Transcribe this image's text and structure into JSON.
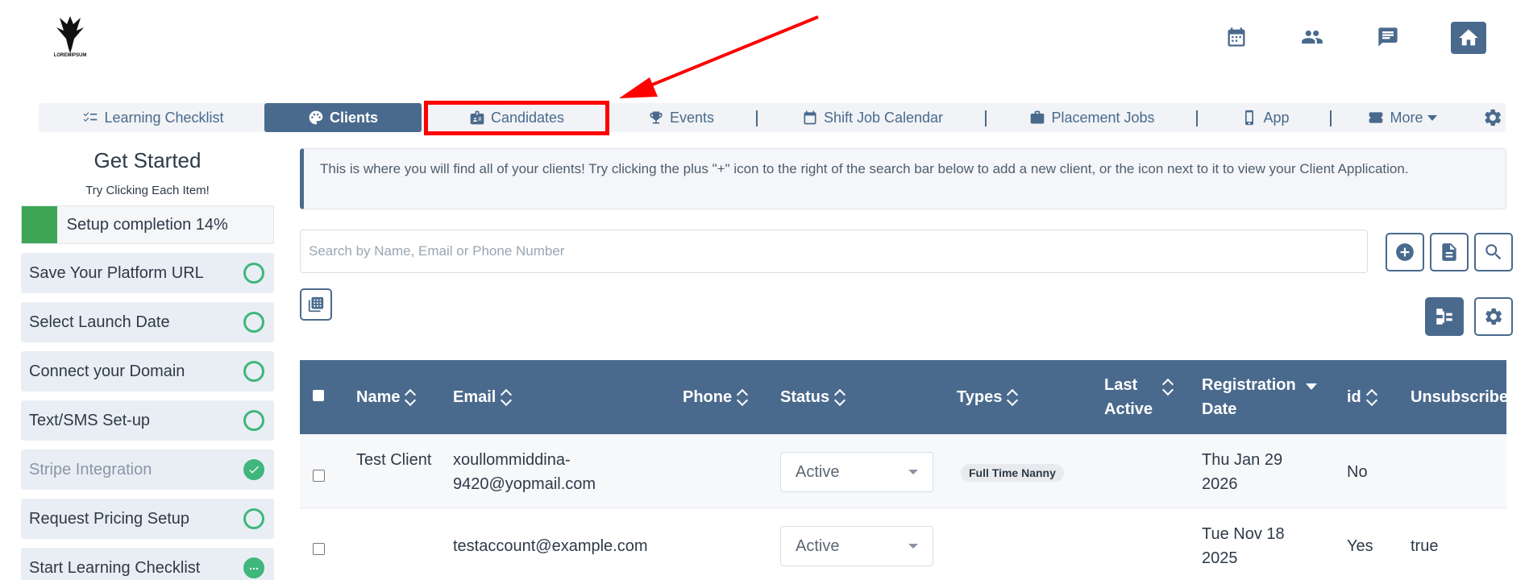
{
  "header": {
    "logo_text": "LOREMIPSUM",
    "icons": [
      "calendar-icon",
      "users-icon",
      "chat-icon",
      "home-icon"
    ]
  },
  "nav": {
    "items": [
      {
        "label": "Learning Checklist",
        "icon": "checklist-icon"
      },
      {
        "label": "Clients",
        "icon": "palette-icon",
        "active": true
      },
      {
        "label": "Candidates",
        "icon": "id-card-icon"
      },
      {
        "label": "Events",
        "icon": "trophy-icon"
      },
      {
        "label": "Shift Job Calendar",
        "icon": "calendar-icon"
      },
      {
        "label": "Placement Jobs",
        "icon": "briefcase-icon"
      },
      {
        "label": "App",
        "icon": "mobile-icon"
      },
      {
        "label": "More",
        "icon": "ticket-icon"
      }
    ]
  },
  "sidebar": {
    "title": "Get Started",
    "subtitle": "Try Clicking Each Item!",
    "progress": {
      "label": "Setup completion 14%",
      "percent": 14
    },
    "items": [
      {
        "label": "Save Your Platform URL",
        "state": "todo"
      },
      {
        "label": "Select Launch Date",
        "state": "todo"
      },
      {
        "label": "Connect your Domain",
        "state": "todo"
      },
      {
        "label": "Text/SMS Set-up",
        "state": "todo"
      },
      {
        "label": "Stripe Integration",
        "state": "done"
      },
      {
        "label": "Request Pricing Setup",
        "state": "todo"
      },
      {
        "label": "Start Learning Checklist",
        "state": "in-progress"
      }
    ]
  },
  "main": {
    "info_text": "This is where you will find all of your clients! Try clicking the plus \"+\" icon to the right of the search bar below to add a new client, or the icon next to it to view your Client Application.",
    "search_placeholder": "Search by Name, Email or Phone Number"
  },
  "table": {
    "columns": [
      "Name",
      "Email",
      "Phone",
      "Status",
      "Types",
      "Last Active",
      "Registration Date",
      "id",
      "Unsubscribed"
    ],
    "rows": [
      {
        "name": "Test Client",
        "email": "xoullommiddina-9420@yopmail.com",
        "phone": "",
        "status": "Active",
        "types": "Full Time Nanny",
        "last_active": "",
        "registration_date": "Thu Jan 29 2026",
        "id": "No",
        "unsubscribed": ""
      },
      {
        "name": "",
        "email": "testaccount@example.com",
        "phone": "",
        "status": "Active",
        "types": "",
        "last_active": "",
        "registration_date": "Tue Nov 18 2025",
        "id": "Yes",
        "unsubscribed": "true"
      }
    ]
  },
  "colors": {
    "primary": "#4a6a8d",
    "success": "#3fb67a",
    "progress": "#3ea556",
    "highlight": "#ff0000"
  }
}
